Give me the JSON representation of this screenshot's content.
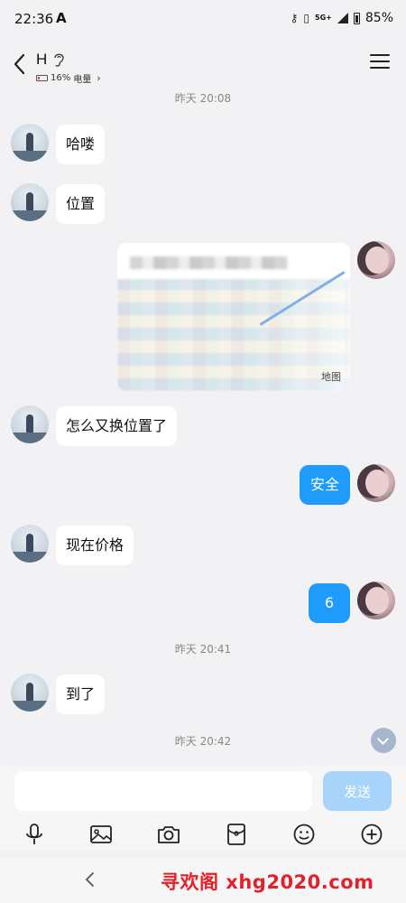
{
  "status_bar": {
    "time": "22:36",
    "notif_letter": "A",
    "network": "5G+",
    "battery_percent": "85%"
  },
  "header": {
    "contact_name": "H",
    "device_battery": "16%",
    "device_label": "电量"
  },
  "messages": [
    {
      "type": "timestamp",
      "text": "昨天 20:08"
    },
    {
      "side": "left",
      "text": "哈喽"
    },
    {
      "side": "left",
      "text": "位置"
    },
    {
      "side": "right",
      "type": "location",
      "map_credit": "地图"
    },
    {
      "side": "left",
      "text": "怎么又换位置了"
    },
    {
      "side": "right",
      "text": "安全"
    },
    {
      "side": "left",
      "text": "现在价格"
    },
    {
      "side": "right",
      "text": "6"
    },
    {
      "type": "timestamp",
      "text": "昨天 20:41"
    },
    {
      "side": "left",
      "text": "到了"
    },
    {
      "type": "timestamp",
      "text": "昨天 20:42"
    }
  ],
  "input": {
    "value": "",
    "placeholder": "",
    "send_label": "发送"
  },
  "toolbar": {
    "icons": [
      "microphone-icon",
      "image-icon",
      "camera-icon",
      "red-packet-icon",
      "emoji-icon",
      "plus-icon"
    ]
  },
  "watermark": "寻欢阁 xhg2020.com",
  "colors": {
    "background": "#f2f2f4",
    "bubble_out": "#1e9bfb",
    "bubble_in": "#ffffff",
    "send_button": "#a8d4fb",
    "watermark": "#e6202b"
  }
}
